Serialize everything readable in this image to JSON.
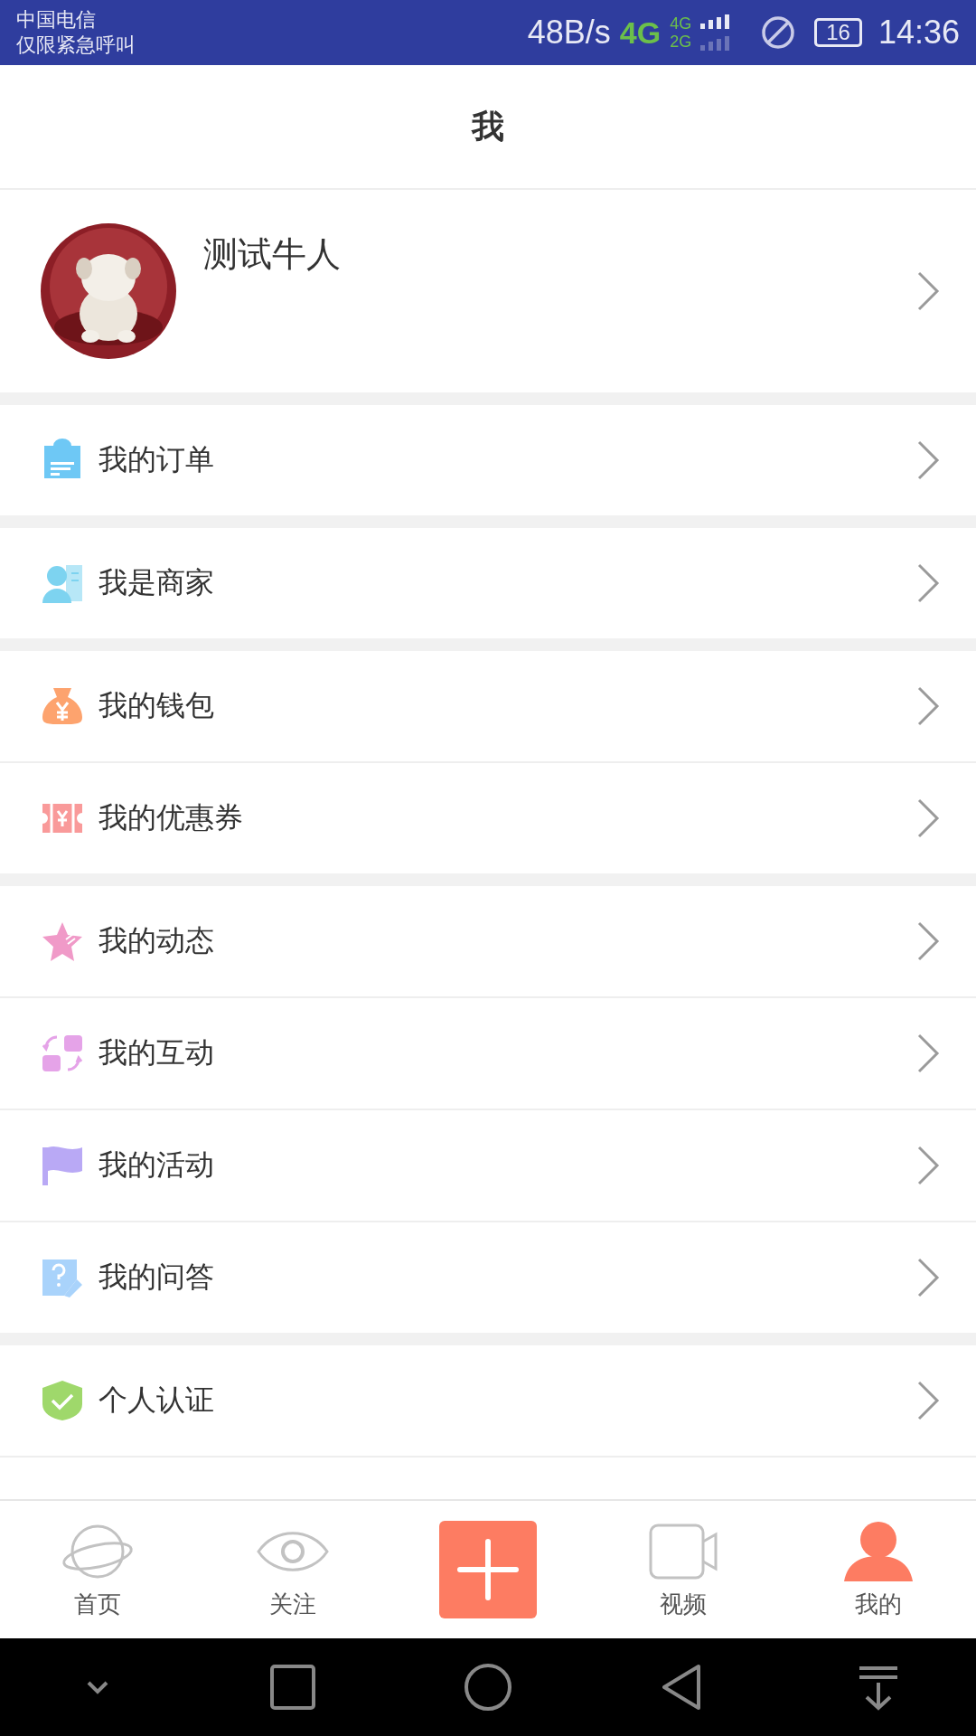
{
  "status_bar": {
    "carrier": "中国电信",
    "emergency": "仅限紧急呼叫",
    "speed": "48B/s",
    "network": "4G",
    "network_sim1": "4G",
    "network_sim2": "2G",
    "battery": "16",
    "time": "14:36"
  },
  "header": {
    "title": "我"
  },
  "profile": {
    "name": "测试牛人"
  },
  "groups": [
    [
      {
        "label": "我的订单",
        "kind": "order"
      }
    ],
    [
      {
        "label": "我是商家",
        "kind": "merchant"
      }
    ],
    [
      {
        "label": "我的钱包",
        "kind": "wallet"
      },
      {
        "label": "我的优惠券",
        "kind": "coupon"
      }
    ],
    [
      {
        "label": "我的动态",
        "kind": "star"
      },
      {
        "label": "我的互动",
        "kind": "interact"
      },
      {
        "label": "我的活动",
        "kind": "flag"
      },
      {
        "label": "我的问答",
        "kind": "question"
      }
    ],
    [
      {
        "label": "个人认证",
        "kind": "shield"
      }
    ]
  ],
  "bottom_nav": [
    {
      "kind": "home",
      "label": "首页",
      "selected": false
    },
    {
      "kind": "follow",
      "label": "关注",
      "selected": false
    },
    {
      "kind": "add",
      "selected": false
    },
    {
      "kind": "video",
      "label": "视频",
      "selected": false
    },
    {
      "kind": "me",
      "label": "我的",
      "selected": true
    }
  ]
}
